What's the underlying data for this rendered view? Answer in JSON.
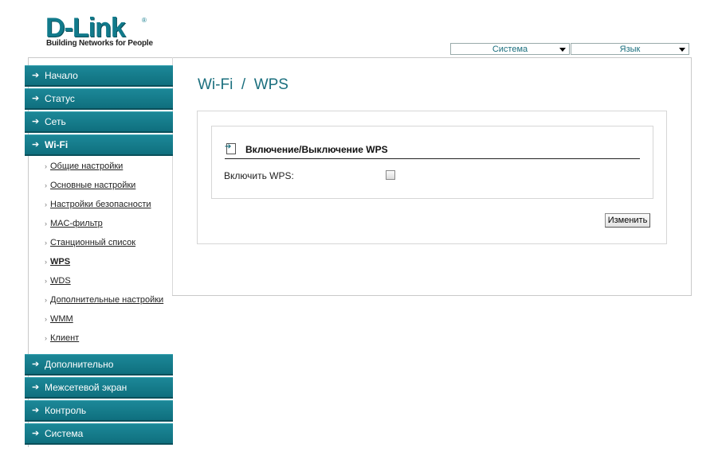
{
  "logo": {
    "brand": "D-Link",
    "tagline": "Building Networks for People",
    "registered": "®"
  },
  "top_menu": {
    "system": {
      "label": "Система",
      "icon": "chevron-down-icon"
    },
    "language": {
      "label": "Язык",
      "icon": "chevron-down-icon"
    }
  },
  "sidebar": {
    "bullet_icon": "➔",
    "sub_bullet": "›",
    "items": [
      {
        "label": "Начало"
      },
      {
        "label": "Статус"
      },
      {
        "label": "Сеть"
      },
      {
        "label": "Wi-Fi",
        "active": true
      },
      {
        "label": "Дополнительно"
      },
      {
        "label": "Межсетевой экран"
      },
      {
        "label": "Контроль"
      },
      {
        "label": "Система"
      }
    ],
    "wifi_subitems": [
      {
        "label": "Общие настройки"
      },
      {
        "label": "Основные настройки"
      },
      {
        "label": "Настройки безопасности"
      },
      {
        "label": "MAC-фильтр"
      },
      {
        "label": "Станционный список"
      },
      {
        "label": "WPS",
        "current": true
      },
      {
        "label": "WDS"
      },
      {
        "label": "Дополнительные настройки"
      },
      {
        "label": "WMM"
      },
      {
        "label": "Клиент"
      }
    ]
  },
  "main": {
    "title": "Wi-Fi  /  WPS",
    "section": {
      "title": "Включение/Выключение WPS",
      "enable_label": "Включить WPS:",
      "enable_checked": false
    },
    "change_button": "Изменить"
  },
  "colors": {
    "accent": "#117a8b",
    "nav_bg": "#0f6f7e",
    "title": "#1b6f7e"
  }
}
